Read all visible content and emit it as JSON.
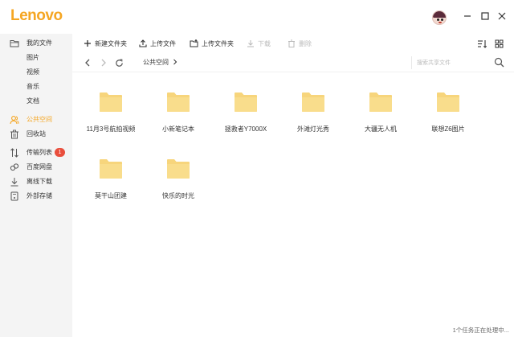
{
  "app": {
    "logo": "Lenovo"
  },
  "titlebar": {
    "avatar_icon": "avatar-icon",
    "buttons": [
      "minimize-icon",
      "maximize-icon",
      "close-icon"
    ]
  },
  "sidebar": {
    "items": [
      {
        "label": "我的文件",
        "icon": "folder-outline-icon"
      },
      {
        "label": "图片"
      },
      {
        "label": "视频"
      },
      {
        "label": "音乐"
      },
      {
        "label": "文档"
      },
      {
        "label": "公共空间",
        "icon": "people-icon",
        "active": true
      },
      {
        "label": "回收站",
        "icon": "trash-icon"
      },
      {
        "label": "传输列表",
        "icon": "transfer-icon",
        "badge": "1"
      },
      {
        "label": "百度网盘",
        "icon": "baidu-icon"
      },
      {
        "label": "离线下载",
        "icon": "download-icon"
      },
      {
        "label": "外部存储",
        "icon": "storage-icon"
      }
    ]
  },
  "toolbar": {
    "new_folder": "新建文件夹",
    "upload_file": "上传文件",
    "upload_folder": "上传文件夹",
    "download": "下载",
    "delete": "删除"
  },
  "navbar": {
    "breadcrumb": "公共空间",
    "search_placeholder": "搜索共享文件"
  },
  "folders": [
    {
      "name": "11月3号航拍视频"
    },
    {
      "name": "小新笔记本"
    },
    {
      "name": "拯救者Y7000X"
    },
    {
      "name": "外滩灯光秀"
    },
    {
      "name": "大疆无人机"
    },
    {
      "name": "联想Z6图片"
    },
    {
      "name": "莫干山团建"
    },
    {
      "name": "快乐的时光"
    }
  ],
  "status": {
    "text": "1个任务正在处理中..."
  },
  "colors": {
    "accent": "#f5a623",
    "folder": "#f7d57c",
    "badge": "#e94e3c",
    "sidebar_bg": "#f4f4f4"
  }
}
